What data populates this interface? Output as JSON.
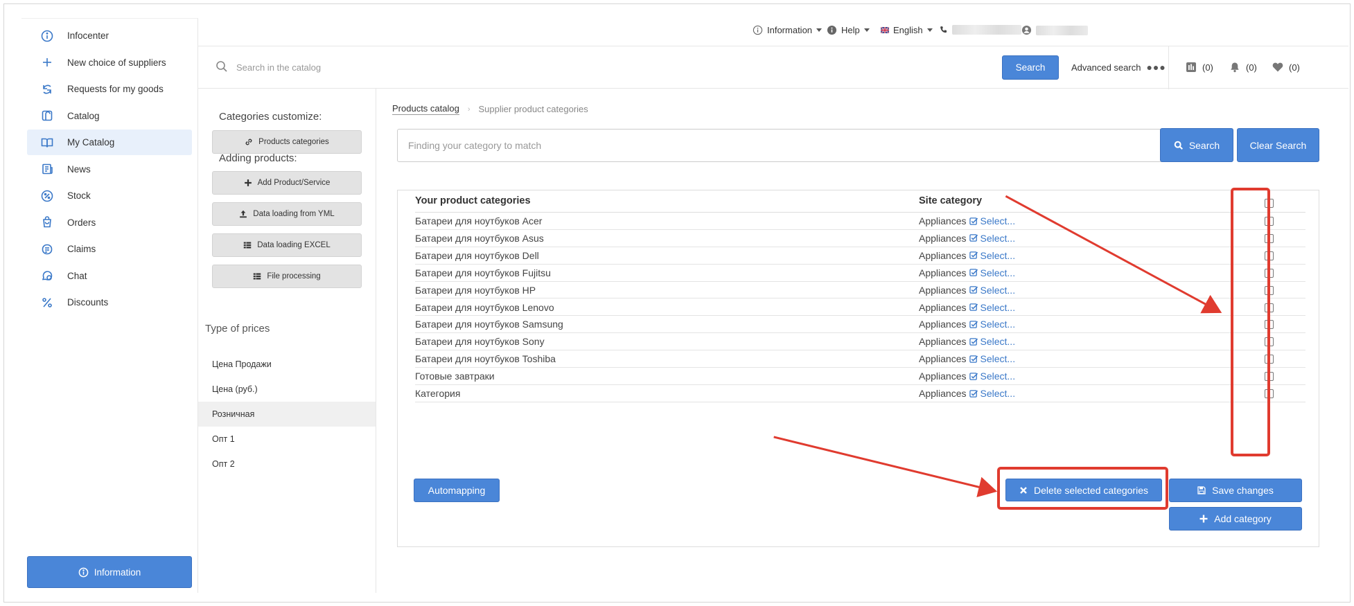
{
  "sidebar": {
    "items": [
      {
        "label": "Infocenter",
        "icon": "info-circle-icon"
      },
      {
        "label": "New choice of suppliers",
        "icon": "plus-icon"
      },
      {
        "label": "Requests for my goods",
        "icon": "exchange-icon"
      },
      {
        "label": "Catalog",
        "icon": "catalog-icon"
      },
      {
        "label": "My Catalog",
        "icon": "book-icon",
        "active": true
      },
      {
        "label": "News",
        "icon": "news-icon"
      },
      {
        "label": "Stock",
        "icon": "percent-badge-icon"
      },
      {
        "label": "Orders",
        "icon": "bag-icon"
      },
      {
        "label": "Claims",
        "icon": "claims-icon"
      },
      {
        "label": "Chat",
        "icon": "chat-icon"
      },
      {
        "label": "Discounts",
        "icon": "percent-icon"
      }
    ],
    "info_button": "Information"
  },
  "topbar": {
    "information": "Information",
    "help": "Help",
    "language": "English"
  },
  "header": {
    "search_placeholder": "Search in the catalog",
    "search_button": "Search",
    "advanced_search": "Advanced search",
    "compare_count": "(0)",
    "notifications_count": "(0)",
    "favorites_count": "(0)"
  },
  "midcol": {
    "categories_heading": "Categories customize:",
    "products_categories": "Products categories",
    "adding_heading": "Adding products:",
    "add_product": "Add Product/Service",
    "yml": "Data loading from YML",
    "excel": "Data loading EXCEL",
    "file_processing": "File processing",
    "prices_heading": "Type of prices",
    "prices": [
      "Цена Продажи",
      "Цена (руб.)",
      "Розничная",
      "Опт 1",
      "Опт 2"
    ],
    "active_price_index": 2
  },
  "breadcrumb": {
    "root": "Products catalog",
    "current": "Supplier product categories"
  },
  "category_search": {
    "placeholder": "Finding your category to match",
    "search_button": "Search",
    "clear_button": "Clear Search"
  },
  "table": {
    "col_your": "Your product categories",
    "col_site": "Site category",
    "select_label": "Select...",
    "rows": [
      {
        "name": "Батареи для ноутбуков Acer",
        "site": "Appliances"
      },
      {
        "name": "Батареи для ноутбуков Asus",
        "site": "Appliances"
      },
      {
        "name": "Батареи для ноутбуков Dell",
        "site": "Appliances"
      },
      {
        "name": "Батареи для ноутбуков Fujitsu",
        "site": "Appliances"
      },
      {
        "name": "Батареи для ноутбуков HP",
        "site": "Appliances"
      },
      {
        "name": "Батареи для ноутбуков Lenovo",
        "site": "Appliances"
      },
      {
        "name": "Батареи для ноутбуков Samsung",
        "site": "Appliances"
      },
      {
        "name": "Батареи для ноутбуков Sony",
        "site": "Appliances"
      },
      {
        "name": "Батареи для ноутбуков Toshiba",
        "site": "Appliances"
      },
      {
        "name": "Готовые завтраки",
        "site": "Appliances"
      },
      {
        "name": "Категория",
        "site": "Appliances"
      }
    ]
  },
  "actions": {
    "automapping": "Automapping",
    "delete_selected": "Delete selected categories",
    "save_changes": "Save changes",
    "add_category": "Add category"
  },
  "colors": {
    "accent": "#4a86d8",
    "annotation": "#e03b2f"
  }
}
